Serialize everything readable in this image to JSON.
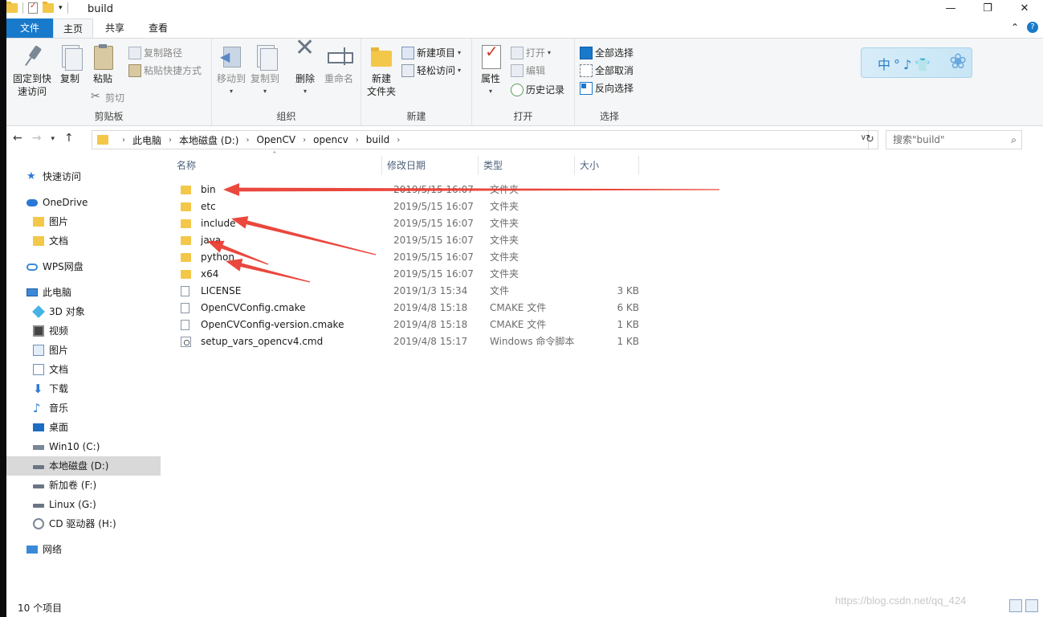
{
  "window": {
    "title": "build",
    "controls": {
      "minimize": "—",
      "maximize": "❐",
      "close": "✕"
    }
  },
  "ribbon_tabs": {
    "file": "文件",
    "home": "主页",
    "share": "共享",
    "view": "查看"
  },
  "ribbon": {
    "clipboard": {
      "pin_label_1": "固定到快",
      "pin_label_2": "速访问",
      "copy": "复制",
      "paste": "粘贴",
      "copy_path": "复制路径",
      "paste_shortcut": "粘贴快捷方式",
      "cut": "剪切",
      "group": "剪贴板"
    },
    "organize": {
      "move_to": "移动到",
      "copy_to": "复制到",
      "delete": "删除",
      "rename": "重命名",
      "group": "组织"
    },
    "new": {
      "new_folder_1": "新建",
      "new_folder_2": "文件夹",
      "new_item": "新建项目",
      "easy_access": "轻松访问",
      "group": "新建"
    },
    "open": {
      "properties": "属性",
      "open": "打开",
      "edit": "编辑",
      "history": "历史记录",
      "group": "打开"
    },
    "select": {
      "select_all": "全部选择",
      "select_none": "全部取消",
      "invert": "反向选择",
      "group": "选择"
    },
    "brand_text": "中°♪👕"
  },
  "address": {
    "crumbs": [
      "此电脑",
      "本地磁盘 (D:)",
      "OpenCV",
      "opencv",
      "build"
    ],
    "search_placeholder": "搜索\"build\""
  },
  "nav": {
    "quick_access": "快速访问",
    "onedrive": "OneDrive",
    "od_pictures": "图片",
    "od_documents": "文档",
    "wps": "WPS网盘",
    "this_pc": "此电脑",
    "objects3d": "3D 对象",
    "videos": "视频",
    "pictures": "图片",
    "documents": "文档",
    "downloads": "下载",
    "music": "音乐",
    "desktop": "桌面",
    "drive_c": "Win10 (C:)",
    "drive_d": "本地磁盘 (D:)",
    "drive_f": "新加卷 (F:)",
    "drive_g": "Linux (G:)",
    "drive_h": "CD 驱动器 (H:)",
    "network": "网络",
    "selected": "本地磁盘 (D:)"
  },
  "columns": {
    "name": "名称",
    "date": "修改日期",
    "type": "类型",
    "size": "大小"
  },
  "files": [
    {
      "name": "bin",
      "date": "2019/5/15 16:07",
      "type": "文件夹",
      "size": "",
      "kind": "folder"
    },
    {
      "name": "etc",
      "date": "2019/5/15 16:07",
      "type": "文件夹",
      "size": "",
      "kind": "folder"
    },
    {
      "name": "include",
      "date": "2019/5/15 16:07",
      "type": "文件夹",
      "size": "",
      "kind": "folder"
    },
    {
      "name": "java",
      "date": "2019/5/15 16:07",
      "type": "文件夹",
      "size": "",
      "kind": "folder"
    },
    {
      "name": "python",
      "date": "2019/5/15 16:07",
      "type": "文件夹",
      "size": "",
      "kind": "folder"
    },
    {
      "name": "x64",
      "date": "2019/5/15 16:07",
      "type": "文件夹",
      "size": "",
      "kind": "folder"
    },
    {
      "name": "LICENSE",
      "date": "2019/1/3 15:34",
      "type": "文件",
      "size": "3 KB",
      "kind": "file"
    },
    {
      "name": "OpenCVConfig.cmake",
      "date": "2019/4/8 15:18",
      "type": "CMAKE 文件",
      "size": "6 KB",
      "kind": "file"
    },
    {
      "name": "OpenCVConfig-version.cmake",
      "date": "2019/4/8 15:18",
      "type": "CMAKE 文件",
      "size": "1 KB",
      "kind": "file"
    },
    {
      "name": "setup_vars_opencv4.cmd",
      "date": "2019/4/8 15:17",
      "type": "Windows 命令脚本",
      "size": "1 KB",
      "kind": "cmd"
    }
  ],
  "annotation_color": "#e8372c",
  "status": {
    "count": "10 个项目"
  },
  "watermark": "https://blog.csdn.net/qq_424"
}
